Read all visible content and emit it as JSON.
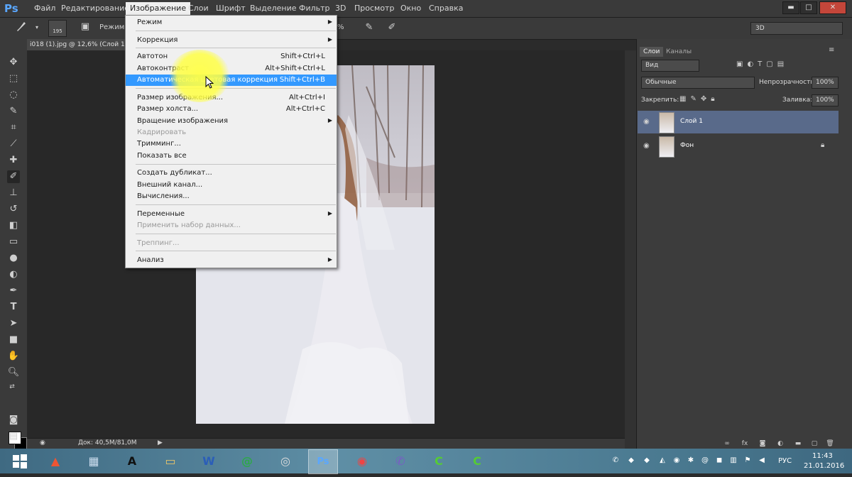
{
  "app": {
    "logo": "Ps"
  },
  "menubar": {
    "items": [
      "Файл",
      "Редактирование",
      "Изображение",
      "Слои",
      "Шрифт",
      "Выделение",
      "Фильтр",
      "3D",
      "Просмотр",
      "Окно",
      "Справка"
    ],
    "active": "Изображение"
  },
  "window_controls": {
    "minimize": "▬",
    "maximize": "□",
    "close": "✕"
  },
  "optionsbar": {
    "brush_size": "195",
    "mode_label": "Режим:",
    "opacity_fragment": "%",
    "workspace": "3D"
  },
  "document": {
    "tab_title": "i018 (1).jpg @ 12,6% (Слой 1,",
    "status": "Док: 40,5M/81,0M"
  },
  "image_menu": {
    "items": [
      {
        "label": "Режим",
        "shortcut": "",
        "submenu": true,
        "disabled": false
      },
      {
        "label": "Коррекция",
        "shortcut": "",
        "submenu": true,
        "disabled": false
      },
      {
        "label": "Автотон",
        "shortcut": "Shift+Ctrl+L",
        "submenu": false,
        "disabled": false
      },
      {
        "label": "Автоконтраст",
        "shortcut": "Alt+Shift+Ctrl+L",
        "submenu": false,
        "disabled": false
      },
      {
        "label": "Автоматическая цветовая коррекция",
        "shortcut": "Shift+Ctrl+B",
        "submenu": false,
        "disabled": false,
        "highlighted": true
      },
      {
        "label": "Размер изображения...",
        "shortcut": "Alt+Ctrl+I",
        "submenu": false,
        "disabled": false
      },
      {
        "label": "Размер холста...",
        "shortcut": "Alt+Ctrl+C",
        "submenu": false,
        "disabled": false
      },
      {
        "label": "Вращение изображения",
        "shortcut": "",
        "submenu": true,
        "disabled": false
      },
      {
        "label": "Кадрировать",
        "shortcut": "",
        "submenu": false,
        "disabled": true
      },
      {
        "label": "Тримминг...",
        "shortcut": "",
        "submenu": false,
        "disabled": false
      },
      {
        "label": "Показать все",
        "shortcut": "",
        "submenu": false,
        "disabled": false
      },
      {
        "label": "Создать дубликат...",
        "shortcut": "",
        "submenu": false,
        "disabled": false
      },
      {
        "label": "Внешний канал...",
        "shortcut": "",
        "submenu": false,
        "disabled": false
      },
      {
        "label": "Вычисления...",
        "shortcut": "",
        "submenu": false,
        "disabled": false
      },
      {
        "label": "Переменные",
        "shortcut": "",
        "submenu": true,
        "disabled": false
      },
      {
        "label": "Применить набор данных...",
        "shortcut": "",
        "submenu": false,
        "disabled": true
      },
      {
        "label": "Треппинг...",
        "shortcut": "",
        "submenu": false,
        "disabled": true
      },
      {
        "label": "Анализ",
        "shortcut": "",
        "submenu": true,
        "disabled": false
      }
    ]
  },
  "layers_panel": {
    "tabs": [
      "Слои",
      "Каналы"
    ],
    "filter": "Вид",
    "blend_mode": "Обычные",
    "opacity_label": "Непрозрачность:",
    "opacity_value": "100%",
    "lock_label": "Закрепить:",
    "fill_label": "Заливка:",
    "fill_value": "100%",
    "layers": [
      {
        "name": "Слой 1",
        "selected": true,
        "locked": false
      },
      {
        "name": "Фон",
        "selected": false,
        "locked": true
      }
    ]
  },
  "taskbar": {
    "language": "РУС",
    "time": "11:43",
    "date": "21.01.2016"
  },
  "colors": {
    "menu_highlight": "#3399ff",
    "ps_blue": "#5aa7ff",
    "selected_layer": "#596a8a"
  }
}
